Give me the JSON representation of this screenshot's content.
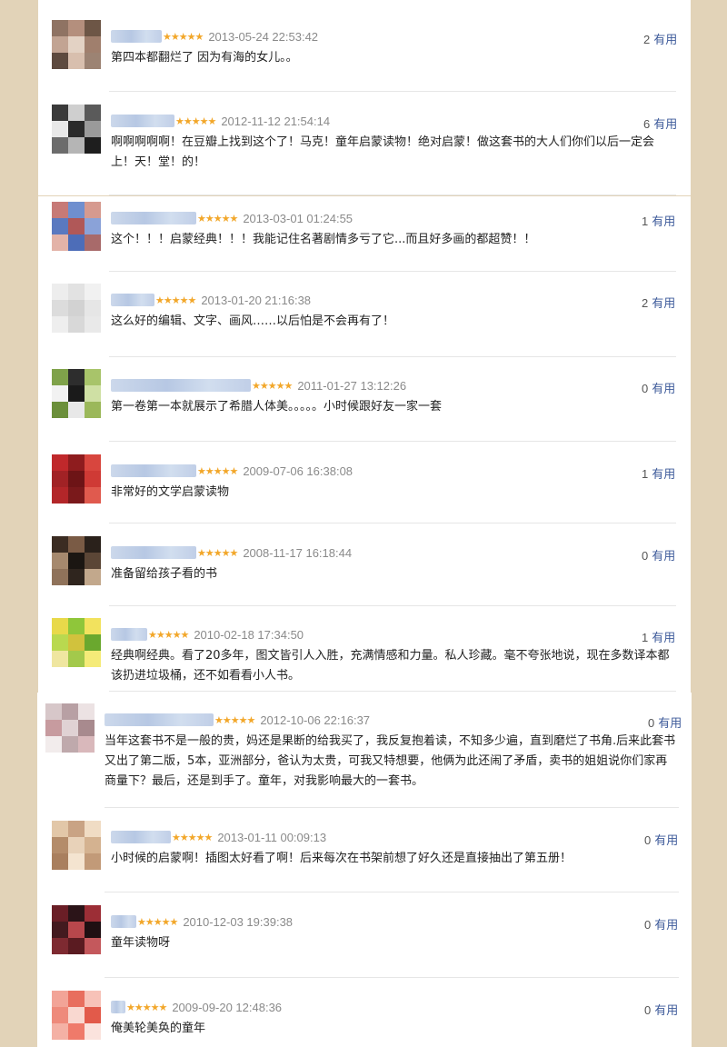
{
  "reviews": [
    {
      "date": "2013-05-24 22:53:42",
      "stars": "★★★★★",
      "useful_count": "2",
      "useful_label": "有用",
      "text": "第四本都翻烂了 因为有海的女儿。。",
      "palette": [
        "#8f7363",
        "#b48f7d",
        "#6d5646",
        "#c2a493",
        "#e3d2c4",
        "#a07f6d",
        "#5d4a3f",
        "#d8bfae",
        "#9c8373"
      ]
    },
    {
      "date": "2012-11-12 21:54:14",
      "stars": "★★★★★",
      "useful_count": "6",
      "useful_label": "有用",
      "text": "啊啊啊啊啊！在豆瓣上找到这个了！马克！童年启蒙读物！绝对启蒙！做这套书的大人们你们以后一定会上！天！堂！的！",
      "palette": [
        "#3a3a3a",
        "#cfcfcf",
        "#5a5a5a",
        "#e8e8e8",
        "#2a2a2a",
        "#9a9a9a",
        "#6c6c6c",
        "#b5b5b5",
        "#1e1e1e"
      ]
    },
    {
      "date": "2013-03-01 01:24:55",
      "stars": "★★★★★",
      "useful_count": "1",
      "useful_label": "有用",
      "text": "这个！！！启蒙经典！！！我能记住名著剧情多亏了它...而且好多画的都超赞！！",
      "palette": [
        "#c77a77",
        "#6f8fcf",
        "#d69a8f",
        "#5a79c0",
        "#b05858",
        "#8aa2d8",
        "#e3b3a8",
        "#4d6db8",
        "#a86a6a"
      ]
    },
    {
      "date": "2013-01-20 21:16:38",
      "stars": "★★★★★",
      "useful_count": "2",
      "useful_label": "有用",
      "text": "这么好的编辑、文字、画风……以后怕是不会再有了！",
      "palette": [
        "#ededed",
        "#e2e2e2",
        "#f1f1f1",
        "#dcdcdc",
        "#d2d2d2",
        "#e6e6e6",
        "#eeeeee",
        "#d8d8d8",
        "#e9e9e9"
      ]
    },
    {
      "date": "2011-01-27 13:12:26",
      "stars": "★★★★★",
      "useful_count": "0",
      "useful_label": "有用",
      "text": "第一卷第一本就展示了希腊人体美。。。。。小时候跟好友一家一套",
      "palette": [
        "#7fa24a",
        "#2d2d2d",
        "#a8c46a",
        "#f2f2f2",
        "#1a1a1a",
        "#cfe0a4",
        "#6b8f3a",
        "#e8e8e8",
        "#9bb85a"
      ]
    },
    {
      "date": "2009-07-06 16:38:08",
      "stars": "★★★★★",
      "useful_count": "1",
      "useful_label": "有用",
      "text": "非常好的文学启蒙读物",
      "palette": [
        "#c0282b",
        "#8e1c1e",
        "#d8463e",
        "#a12225",
        "#6d1416",
        "#cf3a35",
        "#b32629",
        "#7a191b",
        "#e05a4e"
      ]
    },
    {
      "date": "2008-11-17 16:18:44",
      "stars": "★★★★★",
      "useful_count": "0",
      "useful_label": "有用",
      "text": "准备留给孩子看的书",
      "palette": [
        "#3b2c22",
        "#7a5b45",
        "#2a211b",
        "#a6896e",
        "#1b1612",
        "#5b4636",
        "#8f725a",
        "#2f251e",
        "#c2a88c"
      ]
    },
    {
      "date": "2010-02-18 17:34:50",
      "stars": "★★★★★",
      "useful_count": "1",
      "useful_label": "有用",
      "text": "经典啊经典。看了20多年，图文皆引人入胜，充满情感和力量。私人珍藏。毫不夸张地说，现在多数译本都该扔进垃圾桶，还不如看看小人书。",
      "palette": [
        "#e8d94a",
        "#8fc63a",
        "#f2e25e",
        "#b9d94f",
        "#d1c23d",
        "#6aa82e",
        "#efe6a0",
        "#a3c94b",
        "#f5eb78"
      ]
    },
    {
      "date": "2012-10-06 22:16:37",
      "stars": "★★★★★",
      "useful_count": "0",
      "useful_label": "有用",
      "text": "当年这套书不是一般的贵，妈还是果断的给我买了，我反复抱着读，不知多少遍，直到磨烂了书角.后来此套书又出了第二版，5本，亚洲部分，爸认为太贵，可我又特想要，他俩为此还闹了矛盾，卖书的姐姐说你们家再商量下？最后，还是到手了。童年，对我影响最大的一套书。",
      "palette": [
        "#d7c7c9",
        "#b8a0a4",
        "#ece2e3",
        "#c79b9f",
        "#e0d2d4",
        "#a88a8e",
        "#f2ecec",
        "#bfa9ac",
        "#d9b8bb"
      ]
    },
    {
      "date": "2013-01-11 00:09:13",
      "stars": "★★★★★",
      "useful_count": "0",
      "useful_label": "有用",
      "text": "小时候的启蒙啊！插图太好看了啊！后来每次在书架前想了好久还是直接抽出了第五册！",
      "palette": [
        "#e2c7a8",
        "#c9a384",
        "#f0dcc4",
        "#b48c6a",
        "#e8d2b9",
        "#d4b290",
        "#a97f5e",
        "#f4e4d0",
        "#c29a78"
      ]
    },
    {
      "date": "2010-12-03 19:39:38",
      "stars": "★★★★★",
      "useful_count": "0",
      "useful_label": "有用",
      "text": "童年读物呀",
      "palette": [
        "#6a1e26",
        "#2b1418",
        "#9c2e36",
        "#431a1f",
        "#b8474c",
        "#1f0f12",
        "#7e2a31",
        "#5a1b21",
        "#c4585c"
      ]
    },
    {
      "date": "2009-09-20 12:48:36",
      "stars": "★★★★★",
      "useful_count": "0",
      "useful_label": "有用",
      "text": "俺美轮美奂的童年",
      "palette": [
        "#f2a497",
        "#e86e5e",
        "#f7c2b8",
        "#ee8a7b",
        "#f9d8d0",
        "#e25a4a",
        "#f4b1a5",
        "#ef7a6a",
        "#fbe3dd"
      ]
    }
  ]
}
